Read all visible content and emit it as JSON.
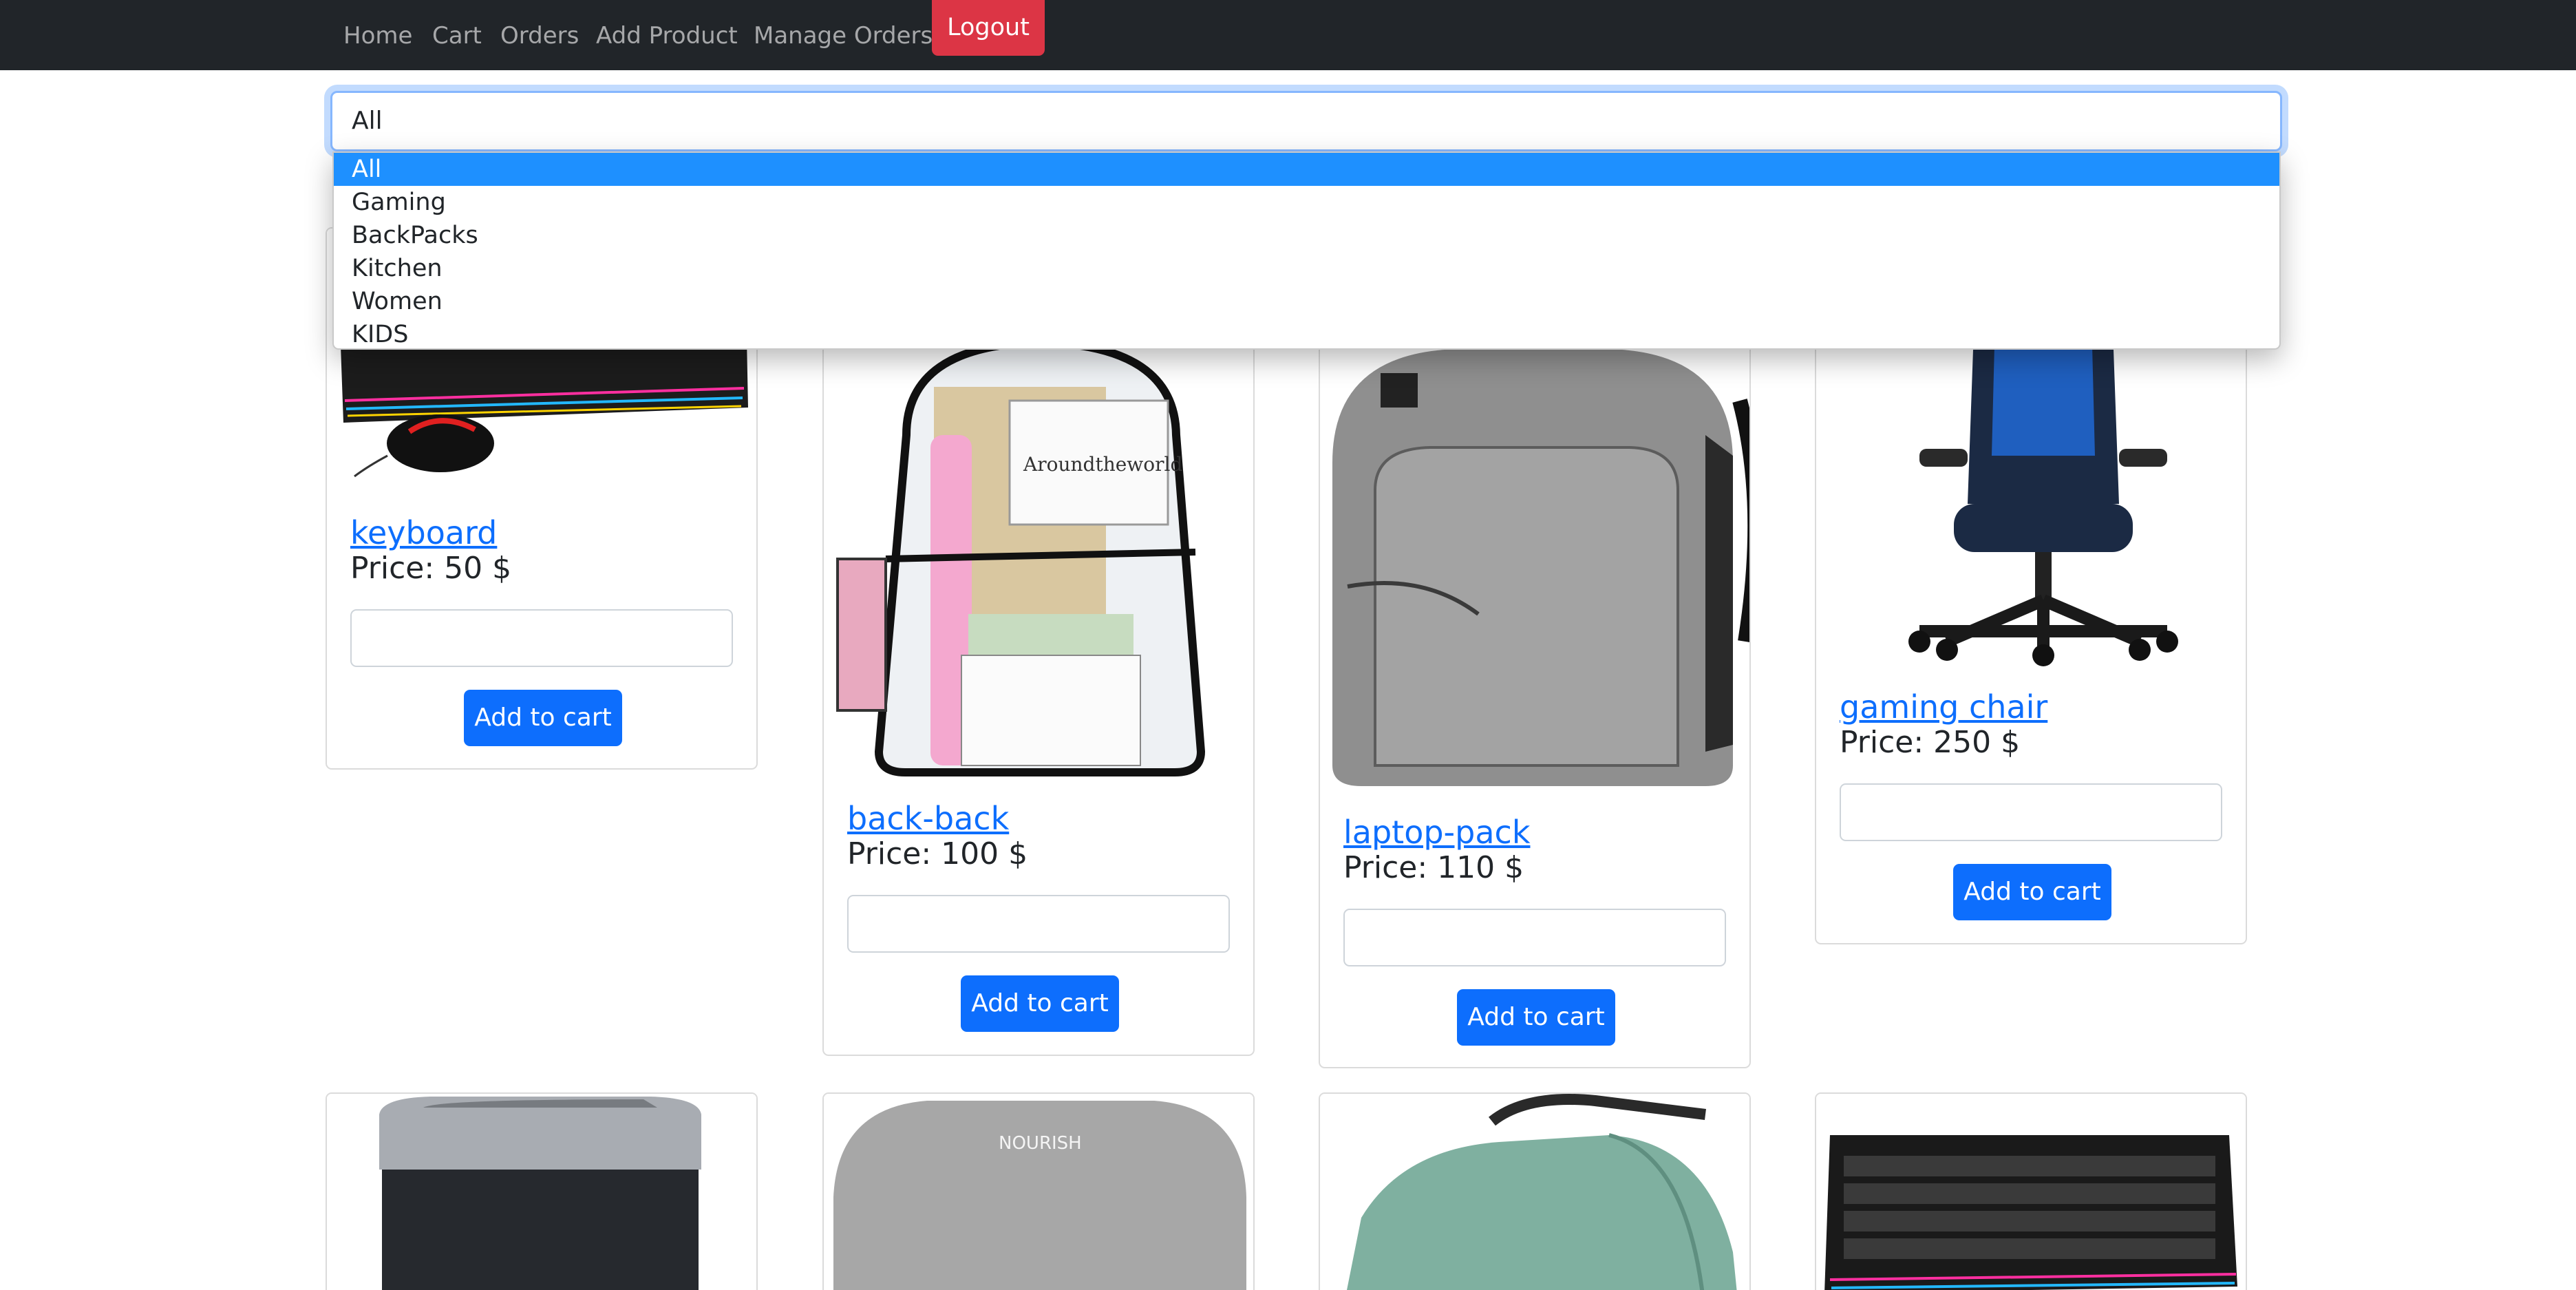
{
  "navbar": {
    "links": [
      "Home",
      "Cart",
      "Orders",
      "Add Product",
      "Manage Orders"
    ],
    "logout": "Logout"
  },
  "filter": {
    "selected": "All",
    "options": [
      "All",
      "Gaming",
      "BackPacks",
      "Kitchen",
      "Women",
      "KIDS"
    ]
  },
  "products": [
    {
      "name": "keyboard",
      "price": "Price: 50 $",
      "button": "Add to cart",
      "icon": "keyboard-mouse-image"
    },
    {
      "name": "back-back",
      "price": "Price: 100 $",
      "button": "Add to cart",
      "icon": "clear-backpack-image"
    },
    {
      "name": "laptop-pack",
      "price": "Price: 110 $",
      "button": "Add to cart",
      "icon": "gray-laptop-backpack-image"
    },
    {
      "name": "gaming chair",
      "price": "Price: 250 $",
      "button": "Add to cart",
      "icon": "gaming-chair-image"
    }
  ],
  "second_row": [
    {
      "icon": "kitchen-bin-image"
    },
    {
      "icon": "scale-image",
      "logo_text": "NOURISH"
    },
    {
      "icon": "green-backpack-image"
    },
    {
      "icon": "keyboard-mouse-image"
    }
  ],
  "colors": {
    "navbar": "#212529",
    "logout": "#dc3545",
    "primary": "#0d6efd",
    "selected_option": "#1e90ff"
  }
}
